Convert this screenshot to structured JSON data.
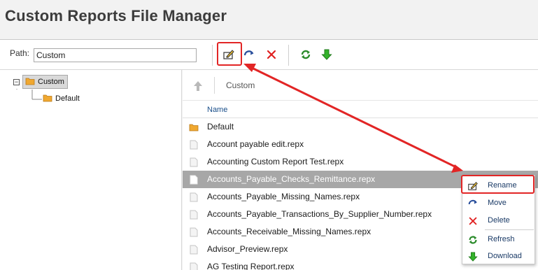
{
  "page": {
    "title": "Custom Reports File Manager"
  },
  "toolbar": {
    "path_label": "Path:",
    "path_value": "Custom",
    "buttons": [
      "rename-icon",
      "move-icon",
      "delete-icon",
      "refresh-icon",
      "download-icon"
    ]
  },
  "tree": {
    "expander": "−",
    "nodes": [
      {
        "label": "Custom",
        "selected": true
      },
      {
        "label": "Default",
        "selected": false
      }
    ]
  },
  "breadcrumb": {
    "current": "Custom"
  },
  "file_list": {
    "column_name": "Name",
    "items": [
      {
        "name": "Default",
        "type": "folder"
      },
      {
        "name": "Account payable edit.repx",
        "type": "file"
      },
      {
        "name": "Accounting Custom Report Test.repx",
        "type": "file"
      },
      {
        "name": "Accounts_Payable_Checks_Remittance.repx",
        "type": "file",
        "selected": true
      },
      {
        "name": "Accounts_Payable_Missing_Names.repx",
        "type": "file"
      },
      {
        "name": "Accounts_Payable_Transactions_By_Supplier_Number.repx",
        "type": "file"
      },
      {
        "name": "Accounts_Receivable_Missing_Names.repx",
        "type": "file"
      },
      {
        "name": "Advisor_Preview.repx",
        "type": "file"
      },
      {
        "name": "AG Testing Report.repx",
        "type": "file"
      }
    ]
  },
  "context_menu": {
    "items": [
      {
        "label": "Rename",
        "icon": "rename-icon"
      },
      {
        "label": "Move",
        "icon": "move-icon"
      },
      {
        "label": "Delete",
        "icon": "delete-icon"
      },
      {
        "label": "Refresh",
        "icon": "refresh-icon"
      },
      {
        "label": "Download",
        "icon": "download-icon"
      }
    ]
  },
  "colors": {
    "annotation": "#e22525",
    "folder": "#f0a830",
    "move_blue": "#2a4f9c",
    "delete_red": "#e02020",
    "refresh_green": "#2a8a2a",
    "download_green": "#33b22a",
    "selected_row": "#a7a7a7"
  }
}
